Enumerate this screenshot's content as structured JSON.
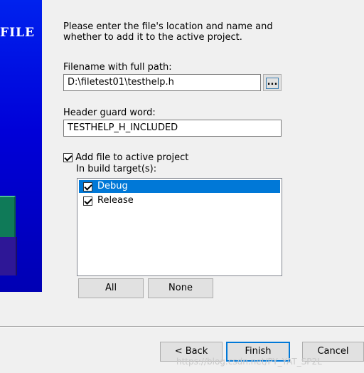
{
  "banner": {
    "title_fragment": "FILE"
  },
  "intro_text_line1": "Please enter the file's location and name and",
  "intro_text_line2": "whether to add it to the active project.",
  "filename": {
    "label": "Filename with full path:",
    "value": "D:\\filetest01\\testhelp.h",
    "browse_label": "..."
  },
  "header_guard": {
    "label": "Header guard word:",
    "value": "TESTHELP_H_INCLUDED"
  },
  "add_to_project": {
    "label": "Add file to active project",
    "checked": true
  },
  "build_targets": {
    "label": "In build target(s):",
    "items": [
      {
        "label": "Debug",
        "checked": true,
        "selected": true
      },
      {
        "label": "Release",
        "checked": true,
        "selected": false
      }
    ]
  },
  "list_buttons": {
    "all": "All",
    "none": "None"
  },
  "footer": {
    "back": "< Back",
    "finish": "Finish",
    "cancel": "Cancel"
  },
  "watermark": "https://blog.csdn.net/PY_YAT_SP2L"
}
